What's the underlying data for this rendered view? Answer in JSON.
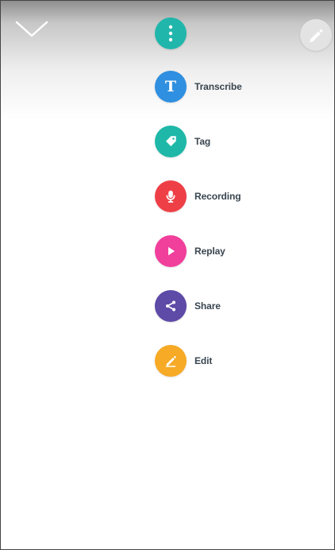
{
  "header": {
    "collapse_icon": "chevron-down-icon",
    "menu_icon": "vertical-dots-icon",
    "edit_icon": "pencil-icon",
    "menu_color": "#21b6ab",
    "edit_button_color": "#e3e3e3"
  },
  "actions": [
    {
      "label": "Transcribe",
      "icon": "t-letter-icon",
      "color": "#2f8fe0"
    },
    {
      "label": "Tag",
      "icon": "tag-icon",
      "color": "#1fb8a8"
    },
    {
      "label": "Recording",
      "icon": "microphone-icon",
      "color": "#ef3f46"
    },
    {
      "label": "Replay",
      "icon": "play-icon",
      "color": "#f13f9c"
    },
    {
      "label": "Share",
      "icon": "share-icon",
      "color": "#5e4aa7"
    },
    {
      "label": "Edit",
      "icon": "pencil-icon",
      "color": "#f6aa25"
    }
  ]
}
